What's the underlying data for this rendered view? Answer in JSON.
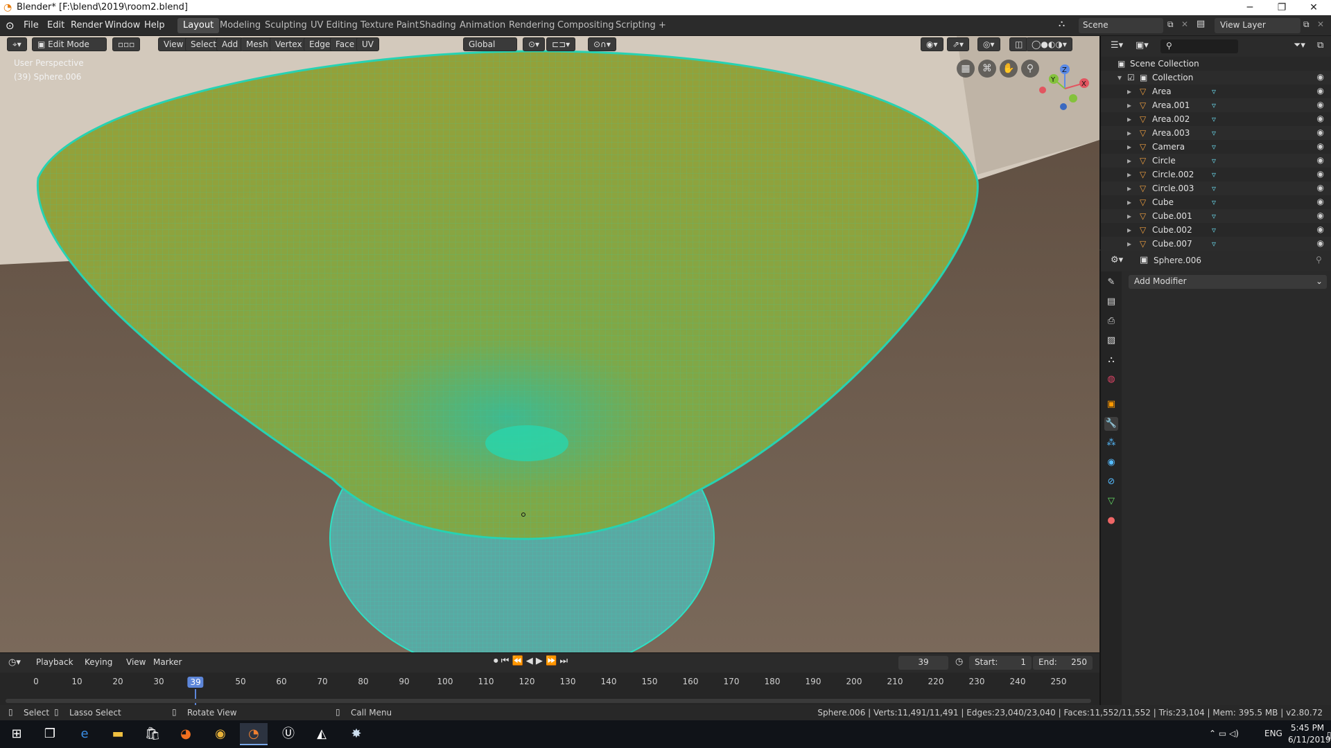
{
  "window": {
    "title": "Blender* [F:\\blend\\2019\\room2.blend]",
    "minimize": "─",
    "restore": "❐",
    "close": "✕"
  },
  "menus": [
    "File",
    "Edit",
    "Render",
    "Window",
    "Help"
  ],
  "workspaces": [
    "Layout",
    "Modeling",
    "Sculpting",
    "UV Editing",
    "Texture Paint",
    "Shading",
    "Animation",
    "Rendering",
    "Compositing",
    "Scripting",
    "+"
  ],
  "scene": {
    "label": "Scene",
    "view_layer": "View Layer"
  },
  "viewport": {
    "mode": "Edit Mode",
    "menus": [
      "View",
      "Select",
      "Add",
      "Mesh",
      "Vertex",
      "Edge",
      "Face",
      "UV"
    ],
    "orientation": "Global",
    "perspective": "User Perspective",
    "object_info": "(39) Sphere.006",
    "gizmo": {
      "x": "X",
      "y": "Y",
      "z": "Z"
    },
    "colors": {
      "floor": "#6b5b4d",
      "wall": "#cfc5b8",
      "mesh_top": "#8a9c3b",
      "mesh_bottom": "#56a7a3",
      "wire": "#27d2b2"
    }
  },
  "outliner": {
    "root": "Scene Collection",
    "collection": "Collection",
    "items": [
      "Area",
      "Area.001",
      "Area.002",
      "Area.003",
      "Camera",
      "Circle",
      "Circle.002",
      "Circle.003",
      "Cube",
      "Cube.001",
      "Cube.002",
      "Cube.007"
    ]
  },
  "properties": {
    "object": "Sphere.006",
    "add_modifier": "Add Modifier"
  },
  "timeline": {
    "menus": [
      "Playback",
      "Keying",
      "View",
      "Marker"
    ],
    "current_frame": "39",
    "start_label": "Start:",
    "start": "1",
    "end_label": "End:",
    "end": "250",
    "ticks": [
      "0",
      "10",
      "20",
      "30",
      "39",
      "50",
      "60",
      "70",
      "80",
      "90",
      "100",
      "110",
      "120",
      "130",
      "140",
      "150",
      "160",
      "170",
      "180",
      "190",
      "200",
      "210",
      "220",
      "230",
      "240",
      "250"
    ]
  },
  "statusbar": {
    "select": "Select",
    "lasso": "Lasso Select",
    "rotate": "Rotate View",
    "call_menu": "Call Menu",
    "stats": "Sphere.006 | Verts:11,491/11,491 | Edges:23,040/23,040 | Faces:11,552/11,552 | Tris:23,104 | Mem: 395.5 MB | v2.80.72"
  },
  "taskbar": {
    "lang": "ENG",
    "time": "5:45 PM",
    "date": "6/11/2019"
  }
}
